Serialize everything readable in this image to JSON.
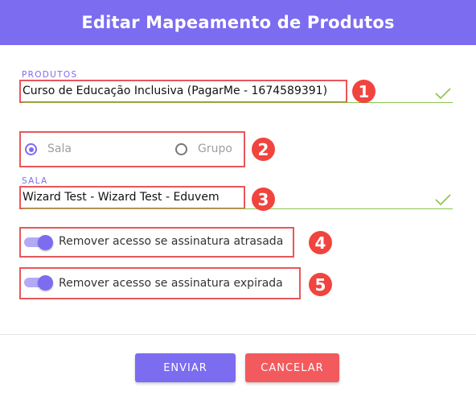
{
  "dialog": {
    "title": "Editar Mapeamento de Produtos"
  },
  "produtos": {
    "label": "PRODUTOS",
    "value": "Curso de Educação Inclusiva (PagarMe - 1674589391)",
    "badge": "1"
  },
  "tipo": {
    "options": [
      {
        "label": "Sala",
        "selected": true
      },
      {
        "label": "Grupo",
        "selected": false
      }
    ],
    "badge": "2"
  },
  "sala": {
    "label": "SALA",
    "value": "Wizard Test - Wizard Test - Eduvem",
    "badge": "3"
  },
  "toggles": [
    {
      "label": "Remover acesso se assinatura atrasada",
      "on": true,
      "badge": "4"
    },
    {
      "label": "Remover acesso se assinatura expirada",
      "on": true,
      "badge": "5"
    }
  ],
  "actions": {
    "submit_label": "ENVIAR",
    "cancel_label": "CANCELAR"
  },
  "colors": {
    "primary": "#7c6cf0",
    "danger": "#f25a5e",
    "highlight": "#e8575a",
    "valid": "#8bc34a"
  }
}
